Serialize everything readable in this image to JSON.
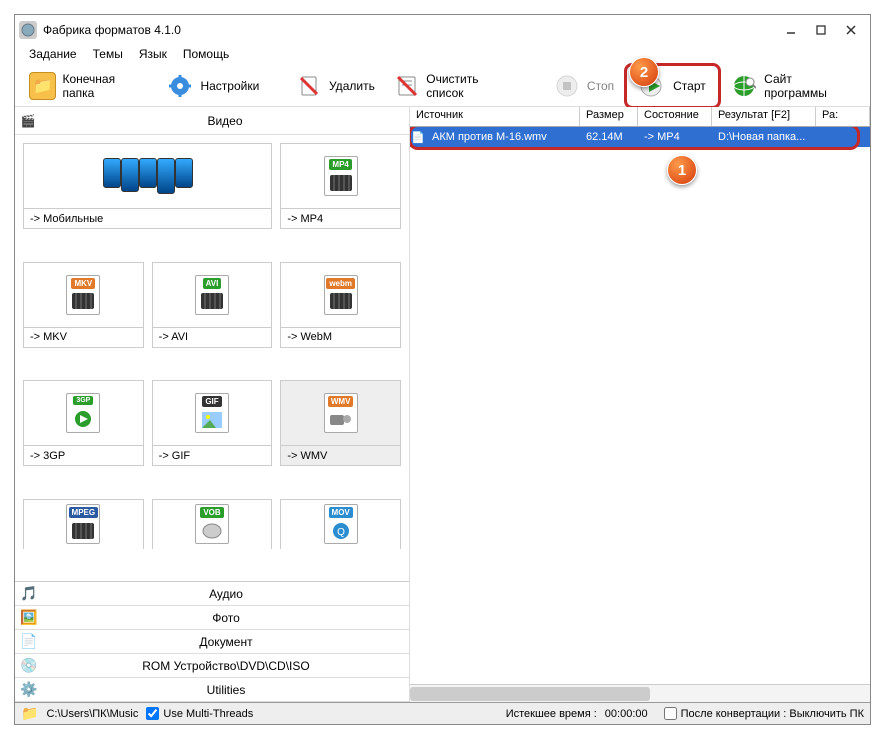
{
  "title": "Фабрика форматов 4.1.0",
  "menu": {
    "task": "Задание",
    "themes": "Темы",
    "language": "Язык",
    "help": "Помощь"
  },
  "toolbar": {
    "target_folder": "Конечная папка",
    "settings": "Настройки",
    "delete": "Удалить",
    "clear_list": "Очистить список",
    "stop": "Стоп",
    "start": "Старт",
    "site": "Сайт программы"
  },
  "left": {
    "header": "Видео",
    "tiles": {
      "mobile": "-> Мобильные",
      "mp4": "-> MP4",
      "mkv": "-> MKV",
      "avi": "-> AVI",
      "webm": "-> WebM",
      "3gp": "-> 3GP",
      "gif": "-> GIF",
      "wmv": "-> WMV"
    },
    "extra_tags": {
      "mpeg": "MPEG",
      "vob": "VOB",
      "mov": "MOV"
    },
    "cats": {
      "audio": "Аудио",
      "photo": "Фото",
      "document": "Документ",
      "rom": "ROM Устройство\\DVD\\CD\\ISO",
      "utilities": "Utilities"
    }
  },
  "list": {
    "headers": {
      "source": "Источник",
      "size": "Размер",
      "state": "Состояние",
      "result": "Результат [F2]",
      "rest": "Ра:"
    },
    "row": {
      "source": "АКМ против М-16.wmv",
      "size": "62.14M",
      "state": "-> MP4",
      "result": "D:\\Новая папка..."
    }
  },
  "status": {
    "path": "C:\\Users\\ПК\\Music",
    "multithread": "Use Multi-Threads",
    "elapsed_label": "Истекшее время : ",
    "elapsed_value": "00:00:00",
    "after": "После конвертации : Выключить ПК"
  },
  "callouts": {
    "one": "1",
    "two": "2"
  }
}
